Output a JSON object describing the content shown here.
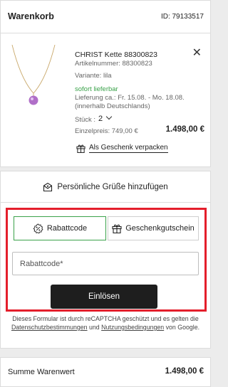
{
  "cart": {
    "title": "Warenkorb",
    "id_label": "ID: 79133517"
  },
  "product": {
    "title": "CHRIST Kette 88300823",
    "article": "Artikelnummer:  88300823",
    "variant": "Variante: lila",
    "availability": "sofort lieferbar",
    "delivery_line1": "Lieferung ca.: Fr. 15.08. - Mo. 18.08.",
    "delivery_line2": "(innerhalb Deutschlands)",
    "qty_label": "Stück :",
    "qty_value": "2",
    "unit_price": "Einzelpreis: 749,00 €",
    "total_price": "1.498,00 €",
    "gift_wrap_label": "Als Geschenk verpacken",
    "remove_symbol": "✕"
  },
  "greetings": {
    "label": "Persönliche Grüße hinzufügen"
  },
  "voucher": {
    "tab_discount": "Rabattcode",
    "tab_gift": "Geschenkgutschein",
    "input_placeholder": "Rabattcode*",
    "input_value": "",
    "redeem_label": "Einlösen",
    "active_tab_color": "#3aa24a",
    "highlight_color": "#e41e2b"
  },
  "recaptcha": {
    "text_before": "Dieses Formular ist durch reCAPTCHA geschützt und es gelten die ",
    "privacy_link": "Datenschutzbestimmungen",
    "middle": " und ",
    "terms_link": "Nutzungsbedingungen",
    "text_after": " von Google."
  },
  "summary": {
    "label": "Summe Warenwert",
    "value": "1.498,00 €"
  },
  "icons": {
    "remove": "close-icon",
    "qty": "chevron-down-icon",
    "gift_wrap": "gift-icon",
    "greetings": "greeting-card-icon",
    "discount": "discount-percent-icon",
    "gift_voucher": "gift-icon"
  }
}
